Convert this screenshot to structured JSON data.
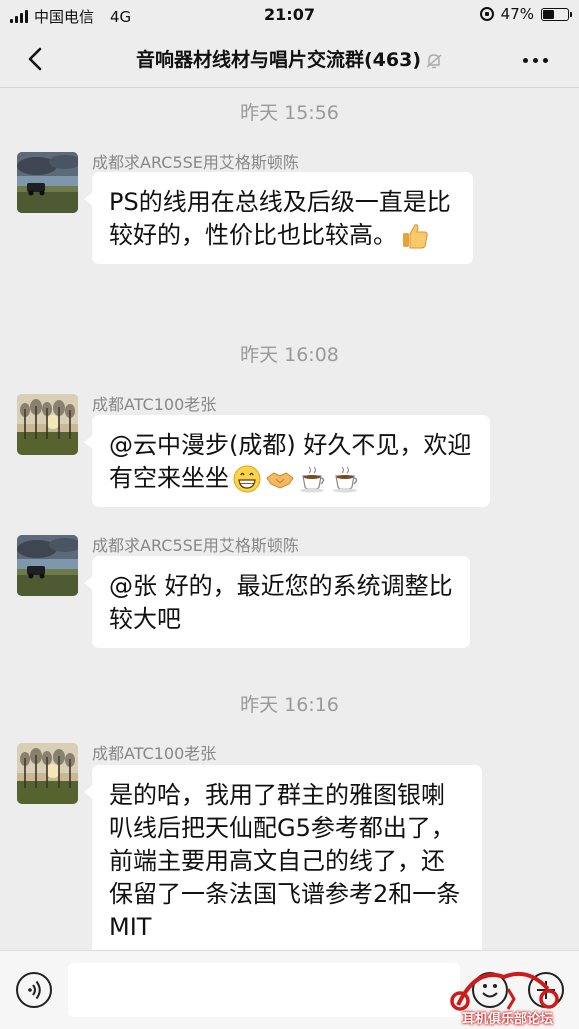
{
  "status_bar": {
    "carrier": "中国电信",
    "network": "4G",
    "time": "21:07",
    "battery": "47%",
    "battery_level": 0.47
  },
  "nav": {
    "title": "音响器材线材与唱片交流群(463)",
    "back_icon": "chevron-left-icon",
    "mute_icon": "bell-off-icon",
    "more_icon": "more-dots-icon"
  },
  "chat": {
    "timestamps": [
      "昨天 15:56",
      "昨天 16:08",
      "昨天 16:16"
    ],
    "messages": [
      {
        "sender": "成都求ARC5SE用艾格斯顿陈",
        "text": "PS的线用在总线及后级一直是比较好的，性价比也比较高。",
        "emojis": [
          "thumbs-up-icon"
        ],
        "avatar": "car-landscape"
      },
      {
        "sender": "成都ATC100老张",
        "text": "@云中漫步(成都) 好久不见，欢迎有空来坐坐",
        "emojis": [
          "grin-icon",
          "handshake-icon",
          "coffee-icon",
          "coffee-icon"
        ],
        "avatar": "trees-sunset"
      },
      {
        "sender": "成都求ARC5SE用艾格斯顿陈",
        "text": "@张 好的，最近您的系统调整比较大吧",
        "emojis": [],
        "avatar": "car-landscape"
      },
      {
        "sender": "成都ATC100老张",
        "text": "是的哈，我用了群主的雅图银喇叭线后把天仙配G5参考都出了，前端主要用高文自己的线了，还保留了一条法国飞谱参考2和一条MIT",
        "emojis": [],
        "avatar": "trees-sunset"
      }
    ]
  },
  "input_bar": {
    "voice_icon": "voice-icon",
    "placeholder": "",
    "emoji_icon": "smiley-icon",
    "plus_icon": "plus-icon"
  },
  "watermark": {
    "text": "耳机俱乐部论坛"
  },
  "colors": {
    "background": "#ededed",
    "bubble": "#ffffff",
    "timestamp": "#9a9a9a",
    "sender": "#888888"
  }
}
